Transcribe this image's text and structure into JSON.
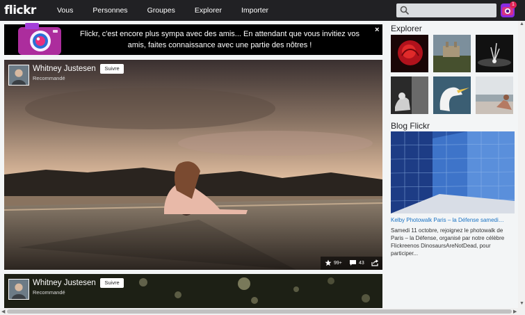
{
  "header": {
    "logo": "flickr",
    "nav": [
      "Vous",
      "Personnes",
      "Groupes",
      "Explorer",
      "Importer"
    ],
    "notification_count": "1"
  },
  "banner": {
    "text": "Flickr, c'est encore plus sympa avec des amis... En attendant que vous invitiez vos amis, faites connaissance avec une partie des nôtres !",
    "close": "×"
  },
  "feed": [
    {
      "user": "Whitney Justesen",
      "sub": "Recommandé",
      "follow": "Suivre",
      "faves": "99+",
      "comments": "43"
    },
    {
      "user": "Whitney Justesen",
      "sub": "Recommandé",
      "follow": "Suivre"
    }
  ],
  "sidebar": {
    "explore_title": "Explorer",
    "blog_title": "Blog Flickr",
    "blog_link": "Kelby Photowalk Paris – la Défense samedi…",
    "blog_desc": "Samedi 11 octobre, rejoignez le photowalk de Paris – la Défense, organisé par notre célèbre Flickreenos DinosaursAreNotDead, pour participer..."
  }
}
